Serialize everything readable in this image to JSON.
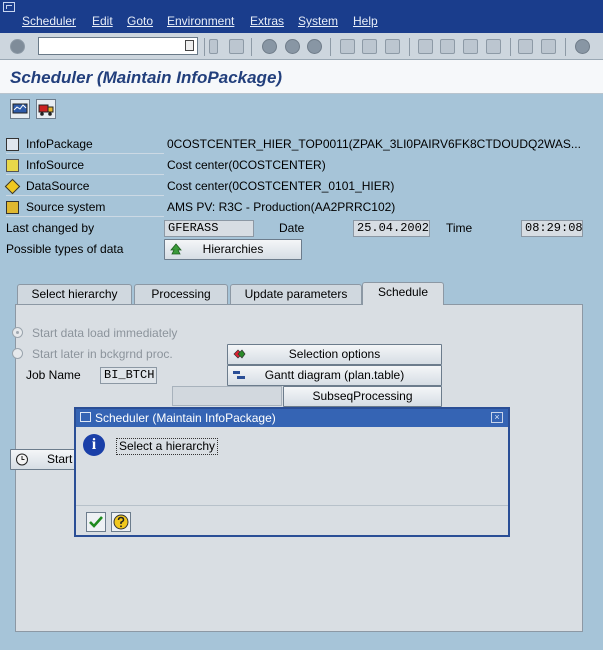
{
  "menu": [
    "Scheduler",
    "Edit",
    "Goto",
    "Environment",
    "Extras",
    "System",
    "Help"
  ],
  "toolbar": {
    "command_value": ""
  },
  "page_title": "Scheduler (Maintain InfoPackage)",
  "info": {
    "infopackage_label": "InfoPackage",
    "infopackage_value": "0COSTCENTER_HIER_TOP0011(ZPAK_3LI0PAIRV6FK8CTDOUDQ2WAS...",
    "infosource_label": "InfoSource",
    "infosource_value": "Cost center(0COSTCENTER)",
    "datasource_label": "DataSource",
    "datasource_value": "Cost center(0COSTCENTER_0101_HIER)",
    "source_system_label": "Source system",
    "source_system_value": "AMS PV: R3C - Production(AA2PRRC102)",
    "last_changed_label": "Last changed by",
    "last_changed_value": "GFERASS",
    "date_label": "Date",
    "date_value": "25.04.2002",
    "time_label": "Time",
    "time_value": "08:29:08",
    "types_label": "Possible types of data",
    "types_button": "Hierarchies"
  },
  "tabs": [
    "Select hierarchy",
    "Processing",
    "Update parameters",
    "Schedule"
  ],
  "schedule": {
    "radio_immediate": "Start data load immediately",
    "radio_later": "Start later in bckgrnd proc.",
    "selection_options": "Selection options",
    "gantt": "Gantt diagram (plan.table)",
    "job_name_label": "Job Name",
    "job_name_value": "BI_BTCH",
    "subseq": "SubseqProcessing",
    "start_button": "Start"
  },
  "dialog": {
    "title": "Scheduler (Maintain InfoPackage)",
    "message": "Select a hierarchy",
    "close_glyph": "×"
  },
  "colors": {
    "menubar": "#1a3d8c",
    "title": "#223f7c",
    "background": "#a6c4d8",
    "dialog_title": "#3564b4"
  }
}
